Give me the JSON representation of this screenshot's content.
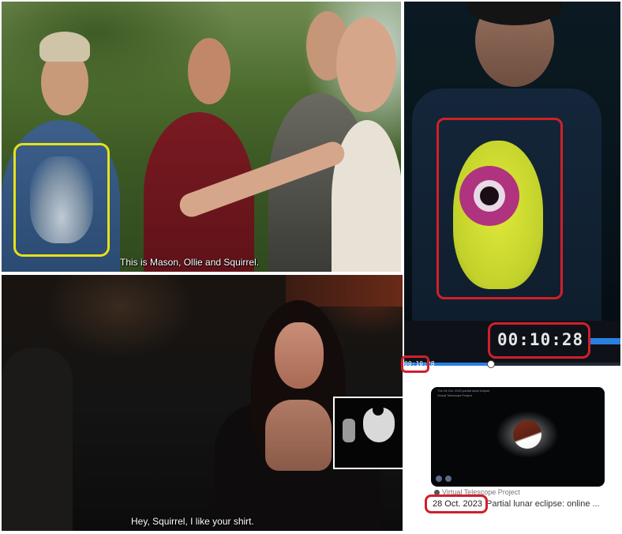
{
  "scene_top_left": {
    "subtitle": "This is Mason, Ollie and Squirrel."
  },
  "scene_bottom_left": {
    "subtitle": "Hey, Squirrel, I like your shirt."
  },
  "shirt_closeup": {
    "timecode": "00:10:28",
    "player_timecode": "00:10:28",
    "progress_fraction": 0.39
  },
  "search_result": {
    "thumbnail_title": "The 28 Oct. 2023 partial lunar eclipse",
    "thumbnail_subtitle": "Virtual Telescope Project",
    "source": "Virtual Telescope Project",
    "date": "28 Oct. 2023",
    "title": "Partial lunar eclipse: online ..."
  },
  "colors": {
    "highlight_yellow": "#e6e21a",
    "highlight_red": "#d0202a",
    "player_accent": "#2a7fe0"
  }
}
